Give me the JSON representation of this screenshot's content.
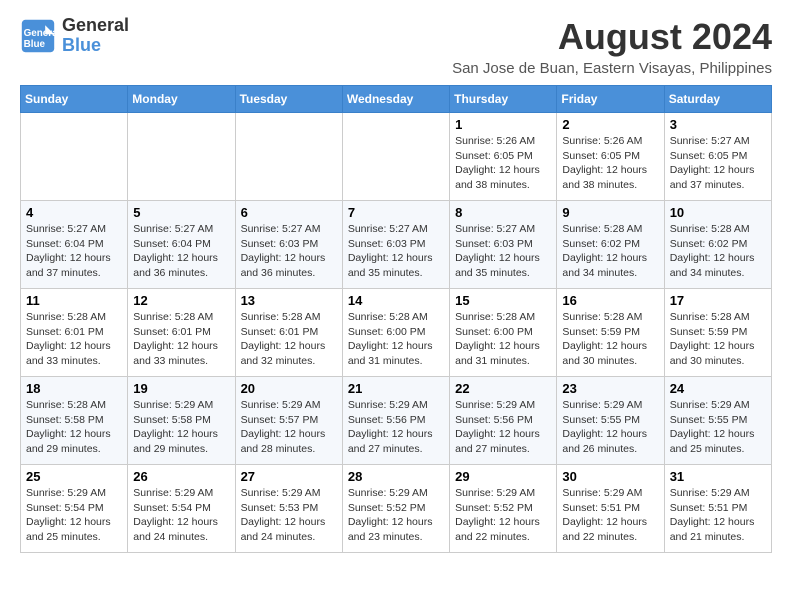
{
  "header": {
    "logo_line1": "General",
    "logo_line2": "Blue",
    "title": "August 2024",
    "subtitle": "San Jose de Buan, Eastern Visayas, Philippines"
  },
  "weekdays": [
    "Sunday",
    "Monday",
    "Tuesday",
    "Wednesday",
    "Thursday",
    "Friday",
    "Saturday"
  ],
  "weeks": [
    [
      {
        "day": "",
        "info": ""
      },
      {
        "day": "",
        "info": ""
      },
      {
        "day": "",
        "info": ""
      },
      {
        "day": "",
        "info": ""
      },
      {
        "day": "1",
        "info": "Sunrise: 5:26 AM\nSunset: 6:05 PM\nDaylight: 12 hours\nand 38 minutes."
      },
      {
        "day": "2",
        "info": "Sunrise: 5:26 AM\nSunset: 6:05 PM\nDaylight: 12 hours\nand 38 minutes."
      },
      {
        "day": "3",
        "info": "Sunrise: 5:27 AM\nSunset: 6:05 PM\nDaylight: 12 hours\nand 37 minutes."
      }
    ],
    [
      {
        "day": "4",
        "info": "Sunrise: 5:27 AM\nSunset: 6:04 PM\nDaylight: 12 hours\nand 37 minutes."
      },
      {
        "day": "5",
        "info": "Sunrise: 5:27 AM\nSunset: 6:04 PM\nDaylight: 12 hours\nand 36 minutes."
      },
      {
        "day": "6",
        "info": "Sunrise: 5:27 AM\nSunset: 6:03 PM\nDaylight: 12 hours\nand 36 minutes."
      },
      {
        "day": "7",
        "info": "Sunrise: 5:27 AM\nSunset: 6:03 PM\nDaylight: 12 hours\nand 35 minutes."
      },
      {
        "day": "8",
        "info": "Sunrise: 5:27 AM\nSunset: 6:03 PM\nDaylight: 12 hours\nand 35 minutes."
      },
      {
        "day": "9",
        "info": "Sunrise: 5:28 AM\nSunset: 6:02 PM\nDaylight: 12 hours\nand 34 minutes."
      },
      {
        "day": "10",
        "info": "Sunrise: 5:28 AM\nSunset: 6:02 PM\nDaylight: 12 hours\nand 34 minutes."
      }
    ],
    [
      {
        "day": "11",
        "info": "Sunrise: 5:28 AM\nSunset: 6:01 PM\nDaylight: 12 hours\nand 33 minutes."
      },
      {
        "day": "12",
        "info": "Sunrise: 5:28 AM\nSunset: 6:01 PM\nDaylight: 12 hours\nand 33 minutes."
      },
      {
        "day": "13",
        "info": "Sunrise: 5:28 AM\nSunset: 6:01 PM\nDaylight: 12 hours\nand 32 minutes."
      },
      {
        "day": "14",
        "info": "Sunrise: 5:28 AM\nSunset: 6:00 PM\nDaylight: 12 hours\nand 31 minutes."
      },
      {
        "day": "15",
        "info": "Sunrise: 5:28 AM\nSunset: 6:00 PM\nDaylight: 12 hours\nand 31 minutes."
      },
      {
        "day": "16",
        "info": "Sunrise: 5:28 AM\nSunset: 5:59 PM\nDaylight: 12 hours\nand 30 minutes."
      },
      {
        "day": "17",
        "info": "Sunrise: 5:28 AM\nSunset: 5:59 PM\nDaylight: 12 hours\nand 30 minutes."
      }
    ],
    [
      {
        "day": "18",
        "info": "Sunrise: 5:28 AM\nSunset: 5:58 PM\nDaylight: 12 hours\nand 29 minutes."
      },
      {
        "day": "19",
        "info": "Sunrise: 5:29 AM\nSunset: 5:58 PM\nDaylight: 12 hours\nand 29 minutes."
      },
      {
        "day": "20",
        "info": "Sunrise: 5:29 AM\nSunset: 5:57 PM\nDaylight: 12 hours\nand 28 minutes."
      },
      {
        "day": "21",
        "info": "Sunrise: 5:29 AM\nSunset: 5:56 PM\nDaylight: 12 hours\nand 27 minutes."
      },
      {
        "day": "22",
        "info": "Sunrise: 5:29 AM\nSunset: 5:56 PM\nDaylight: 12 hours\nand 27 minutes."
      },
      {
        "day": "23",
        "info": "Sunrise: 5:29 AM\nSunset: 5:55 PM\nDaylight: 12 hours\nand 26 minutes."
      },
      {
        "day": "24",
        "info": "Sunrise: 5:29 AM\nSunset: 5:55 PM\nDaylight: 12 hours\nand 25 minutes."
      }
    ],
    [
      {
        "day": "25",
        "info": "Sunrise: 5:29 AM\nSunset: 5:54 PM\nDaylight: 12 hours\nand 25 minutes."
      },
      {
        "day": "26",
        "info": "Sunrise: 5:29 AM\nSunset: 5:54 PM\nDaylight: 12 hours\nand 24 minutes."
      },
      {
        "day": "27",
        "info": "Sunrise: 5:29 AM\nSunset: 5:53 PM\nDaylight: 12 hours\nand 24 minutes."
      },
      {
        "day": "28",
        "info": "Sunrise: 5:29 AM\nSunset: 5:52 PM\nDaylight: 12 hours\nand 23 minutes."
      },
      {
        "day": "29",
        "info": "Sunrise: 5:29 AM\nSunset: 5:52 PM\nDaylight: 12 hours\nand 22 minutes."
      },
      {
        "day": "30",
        "info": "Sunrise: 5:29 AM\nSunset: 5:51 PM\nDaylight: 12 hours\nand 22 minutes."
      },
      {
        "day": "31",
        "info": "Sunrise: 5:29 AM\nSunset: 5:51 PM\nDaylight: 12 hours\nand 21 minutes."
      }
    ]
  ]
}
